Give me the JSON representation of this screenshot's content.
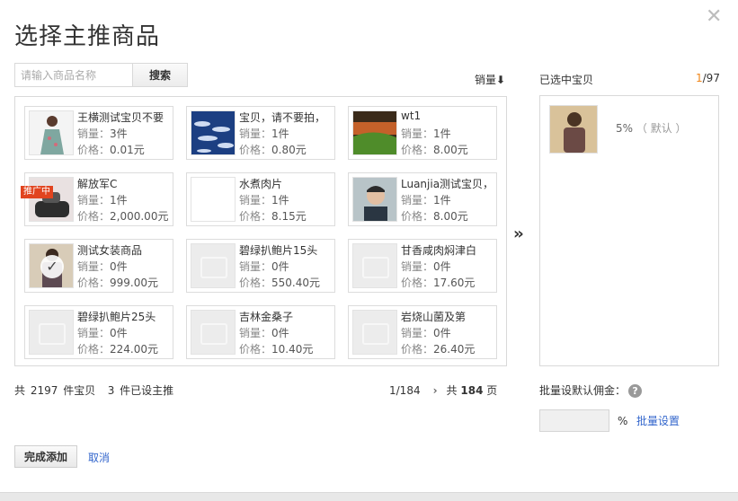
{
  "dialog": {
    "title": "选择主推商品",
    "close_glyph": "✕"
  },
  "search": {
    "placeholder": "请输入商品名称",
    "button_label": "搜索"
  },
  "sort": {
    "label": "销量",
    "arrow": "⬇"
  },
  "products": [
    {
      "name": "王横测试宝贝不要",
      "sales_label": "销量：",
      "sales_value": "3件",
      "price_label": "价格：",
      "price_value": "0.01元",
      "thumb": "dress",
      "badge": "",
      "selected": false
    },
    {
      "name": "宝贝，请不要拍，",
      "sales_label": "销量：",
      "sales_value": "1件",
      "price_label": "价格：",
      "price_value": "0.80元",
      "thumb": "sky",
      "badge": "",
      "selected": false
    },
    {
      "name": "wt1",
      "sales_label": "销量：",
      "sales_value": "1件",
      "price_label": "价格：",
      "price_value": "8.00元",
      "thumb": "landscape",
      "badge": "",
      "selected": false
    },
    {
      "name": "解放军C",
      "sales_label": "销量：",
      "sales_value": "1件",
      "price_label": "价格：",
      "price_value": "2,000.00元",
      "thumb": "shoes",
      "badge": "推广中",
      "selected": false
    },
    {
      "name": "水煮肉片",
      "sales_label": "销量：",
      "sales_value": "1件",
      "price_label": "价格：",
      "price_value": "8.15元",
      "thumb": "blank",
      "badge": "",
      "selected": false
    },
    {
      "name": "Luanjia测试宝贝，",
      "sales_label": "销量：",
      "sales_value": "1件",
      "price_label": "价格：",
      "price_value": "8.00元",
      "thumb": "portrait",
      "badge": "",
      "selected": false
    },
    {
      "name": "测试女装商品",
      "sales_label": "销量：",
      "sales_value": "0件",
      "price_label": "价格：",
      "price_value": "999.00元",
      "thumb": "woman",
      "badge": "",
      "selected": true
    },
    {
      "name": "碧绿扒鲍片15头",
      "sales_label": "销量：",
      "sales_value": "0件",
      "price_label": "价格：",
      "price_value": "550.40元",
      "thumb": "placeholder",
      "badge": "",
      "selected": false
    },
    {
      "name": "甘香咸肉焖津白",
      "sales_label": "销量：",
      "sales_value": "0件",
      "price_label": "价格：",
      "price_value": "17.60元",
      "thumb": "placeholder",
      "badge": "",
      "selected": false
    },
    {
      "name": "碧绿扒鲍片25头",
      "sales_label": "销量：",
      "sales_value": "0件",
      "price_label": "价格：",
      "price_value": "224.00元",
      "thumb": "placeholder",
      "badge": "",
      "selected": false
    },
    {
      "name": "吉林金桑子",
      "sales_label": "销量：",
      "sales_value": "0件",
      "price_label": "价格：",
      "price_value": "10.40元",
      "thumb": "placeholder",
      "badge": "",
      "selected": false
    },
    {
      "name": "岩烧山菌及第",
      "sales_label": "销量：",
      "sales_value": "0件",
      "price_label": "价格：",
      "price_value": "26.40元",
      "thumb": "placeholder",
      "badge": "",
      "selected": false
    }
  ],
  "footer": {
    "total_prefix": "共",
    "total_count": "2197",
    "total_suffix": "件宝贝",
    "featured_count": "3",
    "featured_suffix": "件已设主推"
  },
  "pager": {
    "current": "1/184",
    "next_glyph": "›",
    "total_prefix": "共",
    "total_pages": "184",
    "total_suffix": "页"
  },
  "move_glyph": "››",
  "selected_panel": {
    "label": "已选中宝贝",
    "count_current": "1",
    "count_total": "/97",
    "item_rate": "5%",
    "item_default": "（ 默认 ）"
  },
  "batch": {
    "label": "批量设默认佣金：",
    "help_glyph": "?",
    "percent": "%",
    "set_link": "批量设置",
    "input_value": ""
  },
  "actions": {
    "done_label": "完成添加",
    "cancel_label": "取消"
  },
  "colors": {
    "accent_orange": "#f08519",
    "link_blue": "#3366cc",
    "promo_red": "#e1441f"
  }
}
